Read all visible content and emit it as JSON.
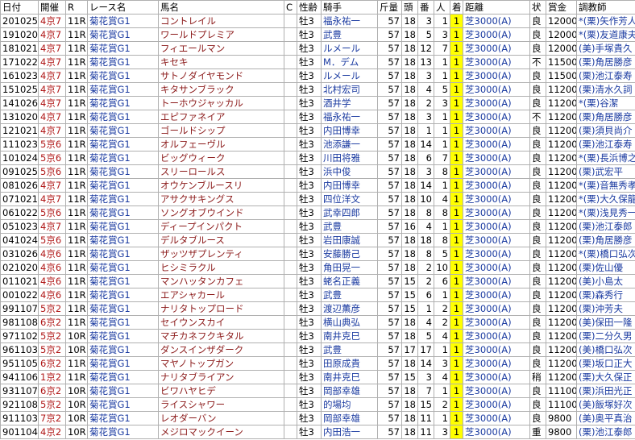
{
  "headers": [
    "日付",
    "開催",
    "R",
    "レース名",
    "馬名",
    "C",
    "性齢",
    "騎手",
    "斤量",
    "頭",
    "番",
    "人",
    "着",
    "距離",
    "状",
    "賞金",
    "調教師"
  ],
  "rows": [
    [
      "201025",
      "4京7",
      "11R",
      "菊花賞G1",
      "コントレイル",
      "",
      "牡3",
      "福永祐一",
      "57",
      "18",
      "3",
      "1",
      "1",
      "芝3000(A)",
      "良",
      "12000",
      "*(栗)矢作芳人"
    ],
    [
      "191020",
      "4京7",
      "11R",
      "菊花賞G1",
      "ワールドプレミア",
      "",
      "牡3",
      "武豊",
      "57",
      "18",
      "5",
      "3",
      "1",
      "芝3000(A)",
      "良",
      "12000",
      "*(栗)友道康夫"
    ],
    [
      "181021",
      "4京7",
      "11R",
      "菊花賞G1",
      "フィエールマン",
      "",
      "牡3",
      "ルメール",
      "57",
      "18",
      "12",
      "7",
      "1",
      "芝3000(A)",
      "良",
      "12000",
      "(美)手塚貴久"
    ],
    [
      "171022",
      "4京7",
      "11R",
      "菊花賞G1",
      "キセキ",
      "",
      "牡3",
      "M．デム",
      "57",
      "18",
      "13",
      "1",
      "1",
      "芝3000(A)",
      "不",
      "11500",
      "(栗)角居勝彦"
    ],
    [
      "161023",
      "4京7",
      "11R",
      "菊花賞G1",
      "サトノダイヤモンド",
      "",
      "牡3",
      "ルメール",
      "57",
      "18",
      "3",
      "1",
      "1",
      "芝3000(A)",
      "良",
      "11500",
      "(栗)池江泰寿"
    ],
    [
      "151025",
      "4京7",
      "11R",
      "菊花賞G1",
      "キタサンブラック",
      "",
      "牡3",
      "北村宏司",
      "57",
      "18",
      "4",
      "5",
      "1",
      "芝3000(A)",
      "良",
      "11200",
      "(栗)清水久詞"
    ],
    [
      "141026",
      "4京7",
      "11R",
      "菊花賞G1",
      "トーホウジャッカル",
      "",
      "牡3",
      "酒井学",
      "57",
      "18",
      "2",
      "3",
      "1",
      "芝3000(A)",
      "良",
      "11200",
      "*(栗)谷潔"
    ],
    [
      "131020",
      "4京7",
      "11R",
      "菊花賞G1",
      "エピファネイア",
      "",
      "牡3",
      "福永祐一",
      "57",
      "18",
      "3",
      "1",
      "1",
      "芝3000(A)",
      "不",
      "11200",
      "(栗)角居勝彦"
    ],
    [
      "121021",
      "4京7",
      "11R",
      "菊花賞G1",
      "ゴールドシップ",
      "",
      "牡3",
      "内田博幸",
      "57",
      "18",
      "1",
      "1",
      "1",
      "芝3000(A)",
      "良",
      "11200",
      "(栗)須貝尚介"
    ],
    [
      "111023",
      "5京6",
      "11R",
      "菊花賞G1",
      "オルフェーヴル",
      "",
      "牡3",
      "池添謙一",
      "57",
      "18",
      "14",
      "1",
      "1",
      "芝3000(A)",
      "良",
      "11200",
      "(栗)池江泰寿"
    ],
    [
      "101024",
      "5京6",
      "11R",
      "菊花賞G1",
      "ビッグウィーク",
      "",
      "牡3",
      "川田将雅",
      "57",
      "18",
      "6",
      "7",
      "1",
      "芝3000(A)",
      "良",
      "11200",
      "*(栗)長浜博之"
    ],
    [
      "091025",
      "5京6",
      "11R",
      "菊花賞G1",
      "スリーロールス",
      "",
      "牡3",
      "浜中俊",
      "57",
      "18",
      "3",
      "8",
      "1",
      "芝3000(A)",
      "良",
      "11200",
      "(栗)武宏平"
    ],
    [
      "081026",
      "4京7",
      "11R",
      "菊花賞G1",
      "オウケンブルースリ",
      "",
      "牡3",
      "内田博幸",
      "57",
      "18",
      "14",
      "1",
      "1",
      "芝3000(A)",
      "良",
      "11200",
      "*(栗)音無秀孝"
    ],
    [
      "071021",
      "4京7",
      "11R",
      "菊花賞G1",
      "アサクサキングス",
      "",
      "牡3",
      "四位洋文",
      "57",
      "18",
      "10",
      "4",
      "1",
      "芝3000(A)",
      "良",
      "11200",
      "*(栗)大久保龍"
    ],
    [
      "061022",
      "5京6",
      "11R",
      "菊花賞G1",
      "ソングオブウインド",
      "",
      "牡3",
      "武幸四郎",
      "57",
      "18",
      "8",
      "8",
      "1",
      "芝3000(A)",
      "良",
      "11200",
      "*(栗)浅見秀一"
    ],
    [
      "051023",
      "4京7",
      "11R",
      "菊花賞G1",
      "ディープインパクト",
      "",
      "牡3",
      "武豊",
      "57",
      "16",
      "4",
      "1",
      "1",
      "芝3000(A)",
      "良",
      "11200",
      "(栗)池江泰郎"
    ],
    [
      "041024",
      "5京6",
      "11R",
      "菊花賞G1",
      "デルタブルース",
      "",
      "牡3",
      "岩田康誠",
      "57",
      "18",
      "18",
      "8",
      "1",
      "芝3000(A)",
      "良",
      "11200",
      "(栗)角居勝彦"
    ],
    [
      "031026",
      "4京6",
      "11R",
      "菊花賞G1",
      "ザッツザプレンティ",
      "",
      "牡3",
      "安藤勝己",
      "57",
      "18",
      "8",
      "5",
      "1",
      "芝3000(A)",
      "良",
      "11200",
      "*(栗)橋口弘次"
    ],
    [
      "021020",
      "4京6",
      "11R",
      "菊花賞G1",
      "ヒシミラクル",
      "",
      "牡3",
      "角田晃一",
      "57",
      "18",
      "2",
      "10",
      "1",
      "芝3000(A)",
      "良",
      "11200",
      "(栗)佐山優"
    ],
    [
      "011021",
      "4京6",
      "11R",
      "菊花賞G1",
      "マンハッタンカフェ",
      "",
      "牡3",
      "蛯名正義",
      "57",
      "15",
      "2",
      "6",
      "1",
      "芝3000(A)",
      "良",
      "11200",
      "(美)小島太"
    ],
    [
      "001022",
      "4京6",
      "11R",
      "菊花賞G1",
      "エアシャカール",
      "",
      "牡3",
      "武豊",
      "57",
      "15",
      "6",
      "1",
      "1",
      "芝3000(A)",
      "良",
      "11200",
      "(栗)森秀行"
    ],
    [
      "991107",
      "5京2",
      "11R",
      "菊花賞G1",
      "ナリタトップロード",
      "",
      "牡3",
      "渡辺薫彦",
      "57",
      "15",
      "1",
      "2",
      "1",
      "芝3000(A)",
      "良",
      "11200",
      "(栗)沖芳夫"
    ],
    [
      "981108",
      "6京2",
      "11R",
      "菊花賞G1",
      "セイウンスカイ",
      "",
      "牡3",
      "横山典弘",
      "57",
      "18",
      "4",
      "2",
      "1",
      "芝3000(A)",
      "良",
      "11200",
      "(美)保田一隆"
    ],
    [
      "971102",
      "5京2",
      "10R",
      "菊花賞G1",
      "マチカネフクキタル",
      "",
      "牡3",
      "南井克巳",
      "57",
      "18",
      "5",
      "4",
      "1",
      "芝3000(A)",
      "良",
      "11200",
      "(栗)二分久男"
    ],
    [
      "961103",
      "5京2",
      "10R",
      "菊花賞G1",
      "ダンスインザダーク",
      "",
      "牡3",
      "武豊",
      "57",
      "17",
      "17",
      "1",
      "1",
      "芝3000(A)",
      "良",
      "11200",
      "(美)橋口弘次"
    ],
    [
      "951105",
      "6京2",
      "11R",
      "菊花賞G1",
      "マヤノトップガン",
      "",
      "牡3",
      "田原成貴",
      "57",
      "18",
      "14",
      "3",
      "1",
      "芝3000(A)",
      "良",
      "11200",
      "(栗)坂口正大"
    ],
    [
      "941106",
      "1京2",
      "11R",
      "菊花賞G1",
      "ナリタブライアン",
      "",
      "牡3",
      "南井克巳",
      "57",
      "15",
      "3",
      "4",
      "1",
      "芝3000(A)",
      "稍",
      "11200",
      "(栗)大久保正"
    ],
    [
      "931107",
      "6京2",
      "10R",
      "菊花賞G1",
      "ビワハヤヒデ",
      "",
      "牡3",
      "岡部幸雄",
      "57",
      "18",
      "7",
      "1",
      "1",
      "芝3000(A)",
      "良",
      "11100",
      "(栗)浜田光正"
    ],
    [
      "921108",
      "5京2",
      "10R",
      "菊花賞G1",
      "ライスシャワー",
      "",
      "牡3",
      "的場均",
      "57",
      "18",
      "15",
      "2",
      "1",
      "芝3000(A)",
      "良",
      "11100",
      "(美)飯塚好次"
    ],
    [
      "911103",
      "7京2",
      "10R",
      "菊花賞G1",
      "レオダーバン",
      "",
      "牡3",
      "岡部幸雄",
      "57",
      "18",
      "11",
      "1",
      "1",
      "芝3000(A)",
      "良",
      "9800",
      "(美)奥平真治"
    ],
    [
      "901104",
      "4京2",
      "10R",
      "菊花賞G1",
      "メジロマックイーン",
      "",
      "牡3",
      "内田浩一",
      "57",
      "18",
      "11",
      "3",
      "1",
      "芝3000(A)",
      "重",
      "9800",
      "(栗)池江泰郎"
    ]
  ]
}
